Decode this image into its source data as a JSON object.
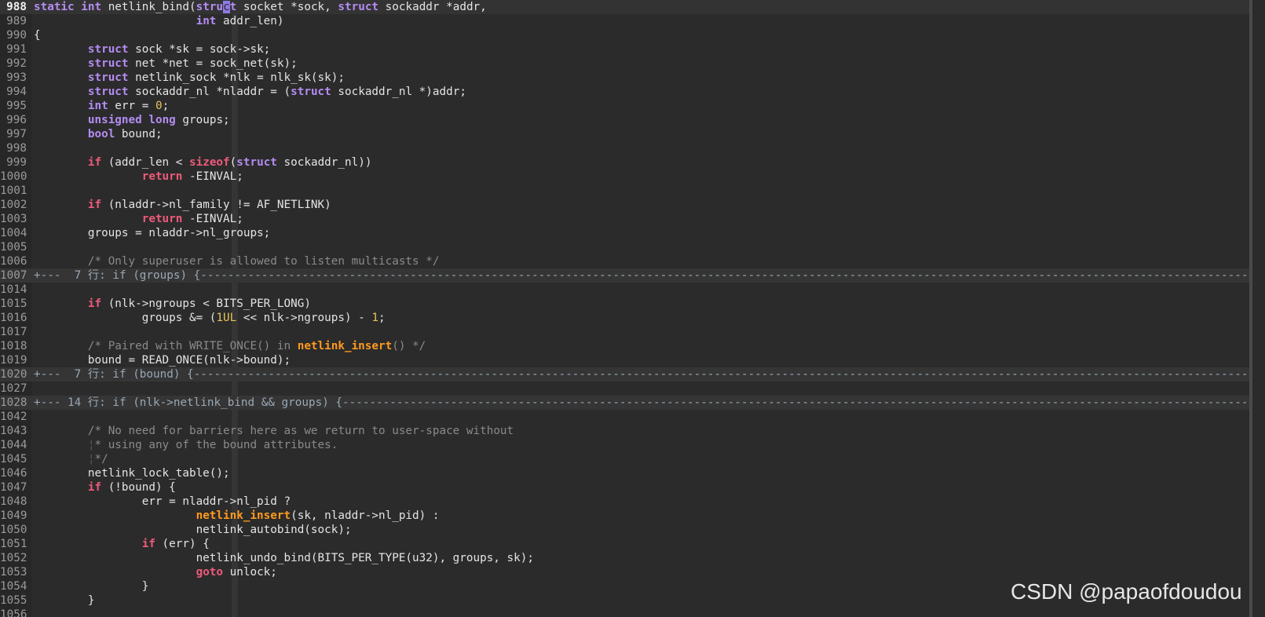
{
  "editor": {
    "watermark": "CSDN @papaofdoudou",
    "colors": {
      "background": "#2b2b2b",
      "keyword": "#b48cf2",
      "control": "#ee5a7a",
      "number": "#e8c35a",
      "comment": "#8a8a8a",
      "highlight": "#ff9a1f",
      "fold": "#9aa7b4"
    },
    "lines": [
      {
        "no": "988",
        "current": true,
        "segs": [
          [
            "kw",
            "static"
          ],
          [
            "t",
            " "
          ],
          [
            "kw",
            "int"
          ],
          [
            "t",
            " netlink_bind("
          ],
          [
            "kw",
            "stru"
          ],
          [
            "cursor",
            "c"
          ],
          [
            "kw",
            "t"
          ],
          [
            "t",
            " socket *sock, "
          ],
          [
            "kw",
            "struct"
          ],
          [
            "t",
            " sockaddr *addr,"
          ]
        ]
      },
      {
        "no": "989",
        "segs": [
          [
            "t",
            "                        "
          ],
          [
            "kw",
            "int"
          ],
          [
            "t",
            " addr_len)"
          ]
        ]
      },
      {
        "no": "990",
        "segs": [
          [
            "t",
            "{"
          ]
        ]
      },
      {
        "no": "991",
        "segs": [
          [
            "t",
            "        "
          ],
          [
            "kw",
            "struct"
          ],
          [
            "t",
            " sock *sk = sock->sk;"
          ]
        ]
      },
      {
        "no": "992",
        "segs": [
          [
            "t",
            "        "
          ],
          [
            "kw",
            "struct"
          ],
          [
            "t",
            " net *net = sock_net(sk);"
          ]
        ]
      },
      {
        "no": "993",
        "segs": [
          [
            "t",
            "        "
          ],
          [
            "kw",
            "struct"
          ],
          [
            "t",
            " netlink_sock *nlk = nlk_sk(sk);"
          ]
        ]
      },
      {
        "no": "994",
        "segs": [
          [
            "t",
            "        "
          ],
          [
            "kw",
            "struct"
          ],
          [
            "t",
            " sockaddr_nl *nladdr = ("
          ],
          [
            "kw",
            "struct"
          ],
          [
            "t",
            " sockaddr_nl *)addr;"
          ]
        ]
      },
      {
        "no": "995",
        "segs": [
          [
            "t",
            "        "
          ],
          [
            "kw",
            "int"
          ],
          [
            "t",
            " err = "
          ],
          [
            "num",
            "0"
          ],
          [
            "t",
            ";"
          ]
        ]
      },
      {
        "no": "996",
        "segs": [
          [
            "t",
            "        "
          ],
          [
            "kw",
            "unsigned"
          ],
          [
            "t",
            " "
          ],
          [
            "kw",
            "long"
          ],
          [
            "t",
            " groups;"
          ]
        ]
      },
      {
        "no": "997",
        "segs": [
          [
            "t",
            "        "
          ],
          [
            "kw",
            "bool"
          ],
          [
            "t",
            " bound;"
          ]
        ]
      },
      {
        "no": "998",
        "segs": []
      },
      {
        "no": "999",
        "segs": [
          [
            "t",
            "        "
          ],
          [
            "ctl",
            "if"
          ],
          [
            "t",
            " (addr_len < "
          ],
          [
            "ctl",
            "sizeof"
          ],
          [
            "t",
            "("
          ],
          [
            "kw",
            "struct"
          ],
          [
            "t",
            " sockaddr_nl))"
          ]
        ]
      },
      {
        "no": "1000",
        "segs": [
          [
            "t",
            "                "
          ],
          [
            "ctl",
            "return"
          ],
          [
            "t",
            " -EINVAL;"
          ]
        ]
      },
      {
        "no": "1001",
        "segs": []
      },
      {
        "no": "1002",
        "segs": [
          [
            "t",
            "        "
          ],
          [
            "ctl",
            "if"
          ],
          [
            "t",
            " (nladdr->nl_family != AF_NETLINK)"
          ]
        ]
      },
      {
        "no": "1003",
        "segs": [
          [
            "t",
            "                "
          ],
          [
            "ctl",
            "return"
          ],
          [
            "t",
            " -EINVAL;"
          ]
        ]
      },
      {
        "no": "1004",
        "segs": [
          [
            "t",
            "        groups = nladdr->nl_groups;"
          ]
        ]
      },
      {
        "no": "1005",
        "segs": []
      },
      {
        "no": "1006",
        "segs": [
          [
            "t",
            "        "
          ],
          [
            "cmt",
            "/* Only superuser is allowed to listen multicasts */"
          ]
        ]
      },
      {
        "no": "1007",
        "fold": true,
        "segs": [
          [
            "fold",
            "+---  7 行: if (groups) {--------------------------------------------------------------------------------------------------------------------------------------------------------------------------------------------------------"
          ]
        ]
      },
      {
        "no": "1014",
        "segs": []
      },
      {
        "no": "1015",
        "segs": [
          [
            "t",
            "        "
          ],
          [
            "ctl",
            "if"
          ],
          [
            "t",
            " (nlk->ngroups < BITS_PER_LONG)"
          ]
        ]
      },
      {
        "no": "1016",
        "segs": [
          [
            "t",
            "                groups &= ("
          ],
          [
            "num",
            "1UL"
          ],
          [
            "t",
            " << nlk->ngroups) - "
          ],
          [
            "num",
            "1"
          ],
          [
            "t",
            ";"
          ]
        ]
      },
      {
        "no": "1017",
        "segs": []
      },
      {
        "no": "1018",
        "segs": [
          [
            "t",
            "        "
          ],
          [
            "cmt",
            "/* Paired with WRITE_ONCE() in "
          ],
          [
            "hl",
            "netlink_insert"
          ],
          [
            "cmt",
            "() */"
          ]
        ]
      },
      {
        "no": "1019",
        "segs": [
          [
            "t",
            "        bound = READ_ONCE(nlk->bound);"
          ]
        ]
      },
      {
        "no": "1020",
        "fold": true,
        "segs": [
          [
            "fold",
            "+---  7 行: if (bound) {---------------------------------------------------------------------------------------------------------------------------------------------------------------------------------------------------------"
          ]
        ]
      },
      {
        "no": "1027",
        "segs": []
      },
      {
        "no": "1028",
        "fold": true,
        "segs": [
          [
            "fold",
            "+--- 14 行: if (nlk->netlink_bind && groups) {------------------------------------------------------------------------------------------------------------------------------------------------------------------------------------------"
          ]
        ]
      },
      {
        "no": "1042",
        "segs": []
      },
      {
        "no": "1043",
        "segs": [
          [
            "t",
            "        "
          ],
          [
            "cmt",
            "/* No need for barriers here as we return to user-space without"
          ]
        ]
      },
      {
        "no": "1044",
        "segs": [
          [
            "t",
            "        "
          ],
          [
            "guide",
            "¦"
          ],
          [
            "cmt",
            "* using any of the bound attributes."
          ]
        ]
      },
      {
        "no": "1045",
        "segs": [
          [
            "t",
            "        "
          ],
          [
            "guide",
            "¦"
          ],
          [
            "cmt",
            "*/"
          ]
        ]
      },
      {
        "no": "1046",
        "segs": [
          [
            "t",
            "        netlink_lock_table();"
          ]
        ]
      },
      {
        "no": "1047",
        "segs": [
          [
            "t",
            "        "
          ],
          [
            "ctl",
            "if"
          ],
          [
            "t",
            " (!bound) {"
          ]
        ]
      },
      {
        "no": "1048",
        "segs": [
          [
            "t",
            "                err = nladdr->nl_pid ?"
          ]
        ]
      },
      {
        "no": "1049",
        "segs": [
          [
            "t",
            "                        "
          ],
          [
            "hl",
            "netlink_insert"
          ],
          [
            "t",
            "(sk, nladdr->nl_pid) :"
          ]
        ]
      },
      {
        "no": "1050",
        "segs": [
          [
            "t",
            "                        netlink_autobind(sock);"
          ]
        ]
      },
      {
        "no": "1051",
        "segs": [
          [
            "t",
            "                "
          ],
          [
            "ctl",
            "if"
          ],
          [
            "t",
            " (err) {"
          ]
        ]
      },
      {
        "no": "1052",
        "segs": [
          [
            "t",
            "                        netlink_undo_bind(BITS_PER_TYPE(u32), groups, sk);"
          ]
        ]
      },
      {
        "no": "1053",
        "segs": [
          [
            "t",
            "                        "
          ],
          [
            "ctl",
            "goto"
          ],
          [
            "t",
            " unlock;"
          ]
        ]
      },
      {
        "no": "1054",
        "segs": [
          [
            "t",
            "                }"
          ]
        ]
      },
      {
        "no": "1055",
        "segs": [
          [
            "t",
            "        }"
          ]
        ]
      },
      {
        "no": "1056",
        "segs": []
      }
    ]
  }
}
